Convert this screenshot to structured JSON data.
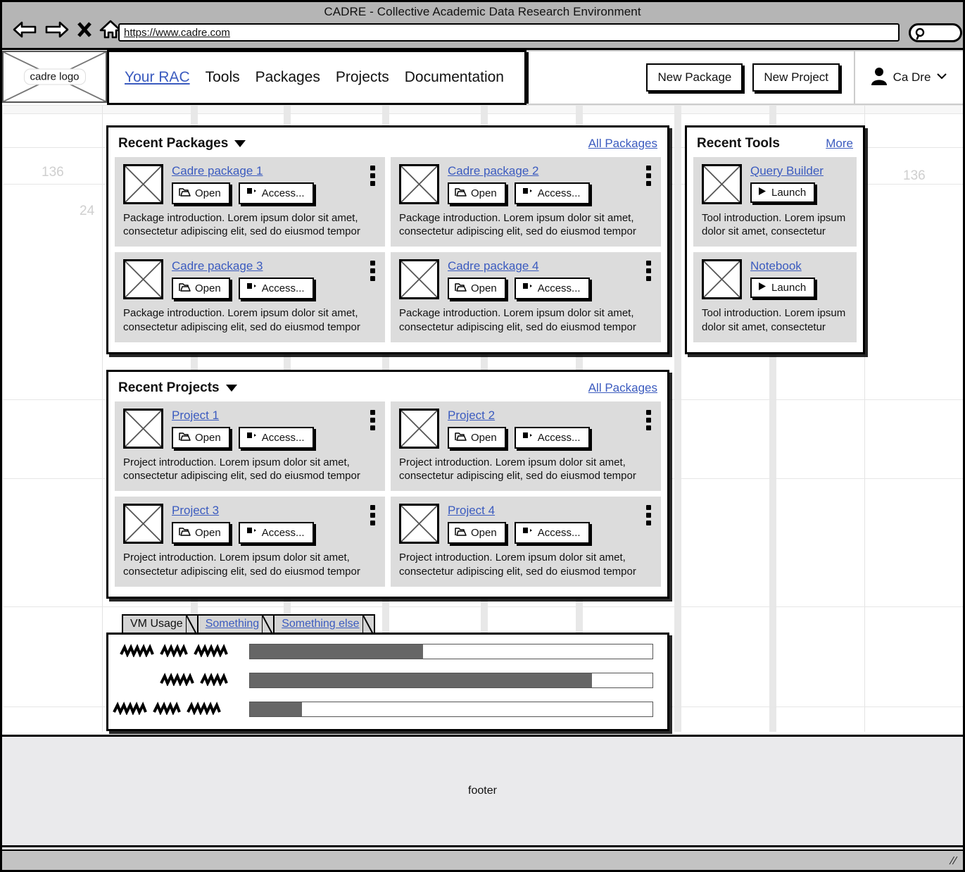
{
  "browser": {
    "title": "CADRE - Collective Academic Data Research Environment",
    "url": "https://www.cadre.com",
    "icons": {
      "back": "back-arrow-icon",
      "forward": "forward-arrow-icon",
      "stop": "close-x-icon",
      "home": "home-icon",
      "search": "search-icon"
    }
  },
  "header": {
    "logo_label": "cadre logo",
    "nav": [
      {
        "label": "Your RAC",
        "active": true
      },
      {
        "label": "Tools",
        "active": false
      },
      {
        "label": "Packages",
        "active": false
      },
      {
        "label": "Projects",
        "active": false
      },
      {
        "label": "Documentation",
        "active": false
      }
    ],
    "new_package": "New Package",
    "new_project": "New Project",
    "user_name": "Ca Dre"
  },
  "background_guides": {
    "left_num": "136",
    "left_num2": "24",
    "right_num": "136"
  },
  "packages_panel": {
    "title": "Recent Packages",
    "link": "All Packages",
    "open_label": "Open",
    "access_label": "Access...",
    "cards": [
      {
        "title": "Cadre package 1",
        "desc": "Package introduction. Lorem ipsum dolor sit amet, consectetur adipiscing elit, sed do eiusmod tempor"
      },
      {
        "title": "Cadre package 2",
        "desc": "Package introduction. Lorem ipsum dolor sit amet, consectetur adipiscing elit, sed do eiusmod tempor"
      },
      {
        "title": "Cadre package 3",
        "desc": "Package introduction. Lorem ipsum dolor sit amet, consectetur adipiscing elit, sed do eiusmod tempor"
      },
      {
        "title": "Cadre package 4",
        "desc": "Package introduction. Lorem ipsum dolor sit amet, consectetur adipiscing elit, sed do eiusmod tempor"
      }
    ]
  },
  "projects_panel": {
    "title": "Recent Projects",
    "link": "All Packages",
    "open_label": "Open",
    "access_label": "Access...",
    "cards": [
      {
        "title": "Project 1",
        "desc": "Project introduction. Lorem ipsum dolor sit amet, consectetur adipiscing elit, sed do eiusmod tempor"
      },
      {
        "title": "Project 2",
        "desc": "Project introduction. Lorem ipsum dolor sit amet, consectetur adipiscing elit, sed do eiusmod tempor"
      },
      {
        "title": "Project 3",
        "desc": "Project introduction. Lorem ipsum dolor sit amet, consectetur adipiscing elit, sed do eiusmod tempor"
      },
      {
        "title": "Project 4",
        "desc": "Project introduction. Lorem ipsum dolor sit amet, consectetur adipiscing elit, sed do eiusmod tempor"
      }
    ]
  },
  "tools_panel": {
    "title": "Recent Tools",
    "link": "More",
    "launch_label": "Launch",
    "cards": [
      {
        "title": "Query Builder",
        "desc": "Tool introduction. Lorem ipsum dolor sit amet, consectetur"
      },
      {
        "title": "Notebook",
        "desc": "Tool introduction. Lorem ipsum dolor sit amet, consectetur"
      }
    ]
  },
  "vm_section": {
    "tabs": [
      {
        "label": "VM Usage",
        "active": true
      },
      {
        "label": "Something",
        "active": false
      },
      {
        "label": "Something else",
        "active": false
      }
    ],
    "chart_data": {
      "type": "bar",
      "title": "VM Usage",
      "orientation": "horizontal",
      "categories": [
        "scribble-label-1",
        "scribble-label-2",
        "scribble-label-3"
      ],
      "values": [
        43,
        85,
        13
      ],
      "xlabel": "",
      "ylabel": "",
      "xlim": [
        0,
        100
      ],
      "grid": false,
      "legend": "none",
      "note": "Axis labels are hand-drawn scribble placeholders (no readable text)."
    }
  },
  "footer": {
    "text": "footer"
  },
  "colors": {
    "link": "#3b5bbf",
    "card_bg": "#dcdcdc",
    "bar_fill": "#666666",
    "chrome": "#b5b5b5",
    "footer_bg": "#eaeaec"
  }
}
